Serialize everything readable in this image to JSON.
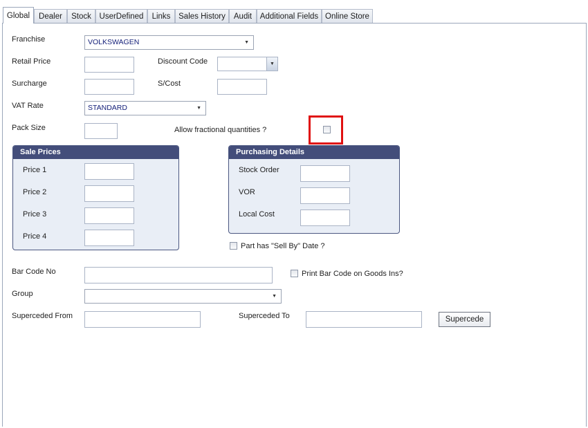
{
  "tabs": [
    "Global",
    "Dealer",
    "Stock",
    "UserDefined",
    "Links",
    "Sales History",
    "Audit",
    "Additional Fields",
    "Online Store"
  ],
  "fields": {
    "franchise_label": "Franchise",
    "franchise_value": "VOLKSWAGEN",
    "retail_price_label": "Retail Price",
    "discount_code_label": "Discount Code",
    "surcharge_label": "Surcharge",
    "scost_label": "S/Cost",
    "vat_rate_label": "VAT Rate",
    "vat_rate_value": "STANDARD",
    "pack_size_label": "Pack Size",
    "fractional_label": "Allow fractional quantities ?",
    "sell_by_label": "Part has \"Sell By\" Date ?",
    "bar_code_label": "Bar Code No",
    "print_bar_code_label": "Print Bar Code on Goods Ins?",
    "group_label": "Group",
    "superceded_from_label": "Superceded From",
    "superceded_to_label": "Superceded To",
    "supercede_button": "Supercede"
  },
  "sale_prices": {
    "title": "Sale Prices",
    "labels": [
      "Price 1",
      "Price 2",
      "Price 3",
      "Price 4"
    ]
  },
  "purchasing": {
    "title": "Purchasing Details",
    "labels": [
      "Stock Order",
      "VOR",
      "Local Cost"
    ]
  },
  "colors": {
    "group_header": "#434d7a",
    "highlight": "#e01010",
    "combo_text": "#15217a"
  }
}
